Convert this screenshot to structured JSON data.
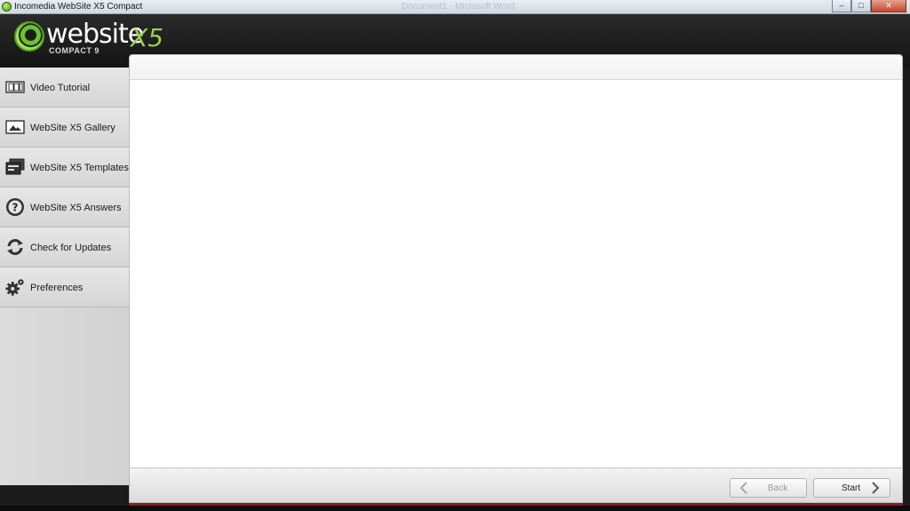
{
  "window": {
    "title": "Incomedia WebSite X5 Compact",
    "background_title": "Document1 - Microsoft Word",
    "controls": [
      "minimize",
      "maximize",
      "close"
    ]
  },
  "logo": {
    "word": "website",
    "suffix": "X5",
    "edition": "COMPACT 9",
    "accent_color": "#8cc63f"
  },
  "sidebar": {
    "items": [
      {
        "label": "Video Tutorial",
        "icon": "film-icon"
      },
      {
        "label": "WebSite X5 Gallery",
        "icon": "image-icon"
      },
      {
        "label": "WebSite X5 Templates",
        "icon": "templates-icon"
      },
      {
        "label": "WebSite X5 Answers",
        "icon": "question-icon"
      },
      {
        "label": "Check for Updates",
        "icon": "refresh-icon"
      },
      {
        "label": "Preferences",
        "icon": "gears-icon"
      }
    ]
  },
  "footer": {
    "back_label": "Back",
    "start_label": "Start",
    "back_enabled": false
  }
}
